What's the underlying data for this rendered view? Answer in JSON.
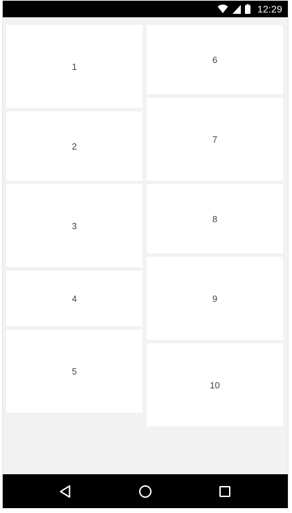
{
  "status_bar": {
    "time": "12:29",
    "icons": [
      "wifi-icon",
      "cell-signal-icon",
      "battery-icon"
    ]
  },
  "grid": {
    "left_column": [
      {
        "label": "1"
      },
      {
        "label": "2"
      },
      {
        "label": "3"
      },
      {
        "label": "4"
      },
      {
        "label": "5"
      }
    ],
    "right_column": [
      {
        "label": "6"
      },
      {
        "label": "7"
      },
      {
        "label": "8"
      },
      {
        "label": "9"
      },
      {
        "label": "10"
      }
    ]
  },
  "nav_bar": {
    "buttons": [
      "back-icon",
      "home-icon",
      "recents-icon"
    ]
  },
  "colors": {
    "background": "#f2f2f2",
    "card": "#ffffff",
    "bars": "#000000",
    "text": "#444444"
  }
}
